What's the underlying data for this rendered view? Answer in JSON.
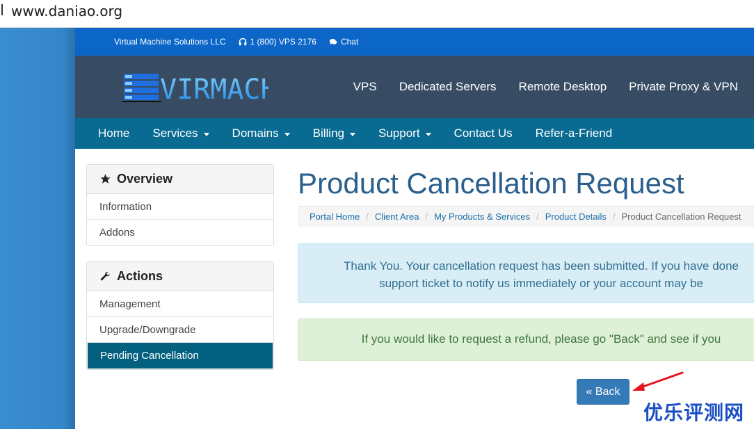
{
  "browser": {
    "url": "www.daniao.org"
  },
  "topbar": {
    "company": "Virtual Machine Solutions LLC",
    "phone": "1 (800) VPS 2176",
    "chat": "Chat"
  },
  "logo": {
    "text": "VIRMACH"
  },
  "mainnav": [
    "VPS",
    "Dedicated Servers",
    "Remote Desktop",
    "Private Proxy & VPN"
  ],
  "subnav": [
    {
      "label": "Home",
      "dropdown": false
    },
    {
      "label": "Services",
      "dropdown": true
    },
    {
      "label": "Domains",
      "dropdown": true
    },
    {
      "label": "Billing",
      "dropdown": true
    },
    {
      "label": "Support",
      "dropdown": true
    },
    {
      "label": "Contact Us",
      "dropdown": false
    },
    {
      "label": "Refer-a-Friend",
      "dropdown": false
    }
  ],
  "sidebar": {
    "overview": {
      "title": "Overview",
      "items": [
        "Information",
        "Addons"
      ]
    },
    "actions": {
      "title": "Actions",
      "items": [
        "Management",
        "Upgrade/Downgrade",
        "Pending Cancellation"
      ],
      "active_index": 2
    }
  },
  "main": {
    "title": "Product Cancellation Request",
    "breadcrumb": [
      "Portal Home",
      "Client Area",
      "My Products & Services",
      "Product Details"
    ],
    "breadcrumb_current": "Product Cancellation Request",
    "info_line1": "Thank You. Your cancellation request has been submitted. If you have done",
    "info_line2": "support ticket to notify us immediately or your account may be",
    "success_text": "If you would like to request a refund, please go \"Back\" and see if you",
    "back_label": "« Back"
  },
  "watermark": "优乐评测网",
  "colors": {
    "topbar": "#0b66c8",
    "header": "#374c63",
    "subnav": "#0a6b92",
    "accent": "#337ab7",
    "active_item": "#03607f",
    "annotation_arrow": "#e8141b"
  }
}
